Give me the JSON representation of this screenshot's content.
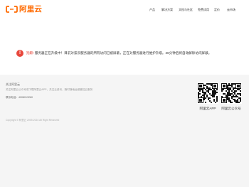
{
  "header": {
    "logo_text": "阿里云",
    "nav": [
      {
        "label": "产品"
      },
      {
        "label": "解决方案"
      },
      {
        "label": "文档与社区"
      },
      {
        "label": "免费试用"
      },
      {
        "label": "定价"
      },
      {
        "label": "云市场"
      }
    ],
    "brand_color": "#ff6a00"
  },
  "alert": {
    "icon": "exclamation-icon",
    "strong": "抱歉!",
    "message": "服务器正在升级中！目前对该云服务器的所有访问已被屏蔽，正在对服务器进行维护升级。36分钟后将自动解除访问屏蔽。",
    "color": "#e8473c"
  },
  "footer": {
    "title": "关注阿里云",
    "description": "关注阿里云公众号或下载阿里云APP，关注云资讯，随时随地运维管控云服务",
    "phone": "联系电话：4008013260",
    "copyright": "Copyright © 阿里云 2009-2024 All Right Reserved",
    "qr_codes": [
      {
        "label": "阿里云APP",
        "icon": "qr-code-icon"
      },
      {
        "label": "阿里云公众号",
        "icon": "qr-code-icon"
      }
    ]
  }
}
